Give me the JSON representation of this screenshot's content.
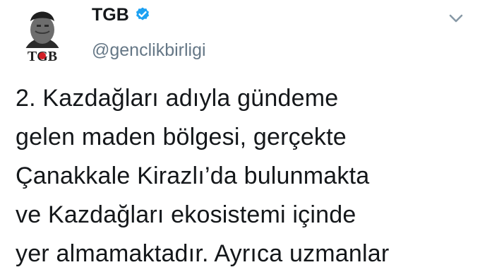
{
  "tweet": {
    "avatar_text": "TGB",
    "display_name": "TGB",
    "handle": "@genclikbirligi",
    "body_lines": [
      "2.  Kazdağları adıyla gündeme",
      "gelen maden bölgesi, gerçekte",
      "Çanakkale Kirazlı’da bulunmakta",
      "ve Kazdağları ekosistemi içinde",
      "yer almamaktadır. Ayrıca uzmanlar"
    ],
    "verified_color": "#1da1f2",
    "caret_color": "#8899a6"
  },
  "icons": {
    "verified": "verified-badge-icon",
    "caret": "chevron-down-icon"
  }
}
